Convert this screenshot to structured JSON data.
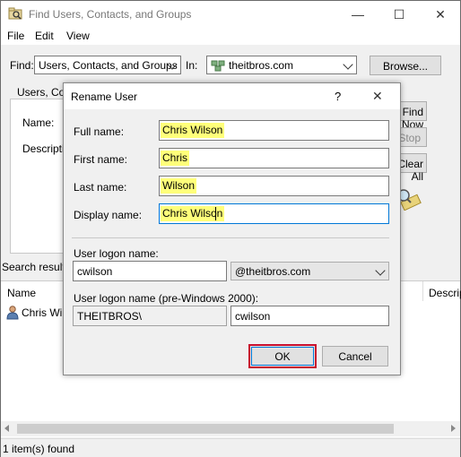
{
  "app": {
    "title": "Find Users, Contacts, and Groups"
  },
  "window_controls": {
    "minimize": "—",
    "maximize": "☐",
    "close": "✕"
  },
  "menu": [
    "File",
    "Edit",
    "View"
  ],
  "find_bar": {
    "find_label": "Find:",
    "find_value": "Users, Contacts, and Groups",
    "in_label": "In:",
    "in_value": "theitbros.com",
    "browse_label": "Browse..."
  },
  "tab": {
    "label": "Users, Cont"
  },
  "search_panel": {
    "name_label": "Name:",
    "description_label": "Descripti"
  },
  "actions": {
    "find_now": "Find Now",
    "stop": "Stop",
    "clear_all": "Clear All"
  },
  "results": {
    "label": "Search results:",
    "columns": [
      "Name",
      "Descrip"
    ],
    "rows": [
      {
        "name": "Chris Wil"
      }
    ],
    "status": "1 item(s) found"
  },
  "dialog": {
    "title": "Rename User",
    "help": "?",
    "close": "✕",
    "full_name_label": "Full name:",
    "full_name_value": "Chris Wilson",
    "first_name_label": "First name:",
    "first_name_value": "Chris",
    "last_name_label": "Last name:",
    "last_name_value": "Wilson",
    "display_name_label": "Display name:",
    "display_name_value": "Chris Wilson",
    "logon_label": "User logon name:",
    "logon_value": "cwilson",
    "upn_suffix": "@theitbros.com",
    "pre2000_label": "User logon name (pre-Windows 2000):",
    "pre2000_domain": "THEITBROS\\",
    "pre2000_value": "cwilson",
    "ok_label": "OK",
    "cancel_label": "Cancel"
  },
  "colors": {
    "highlight": "#ffff7a",
    "ok_border": "#c8102e",
    "focus_border": "#0078d7"
  }
}
